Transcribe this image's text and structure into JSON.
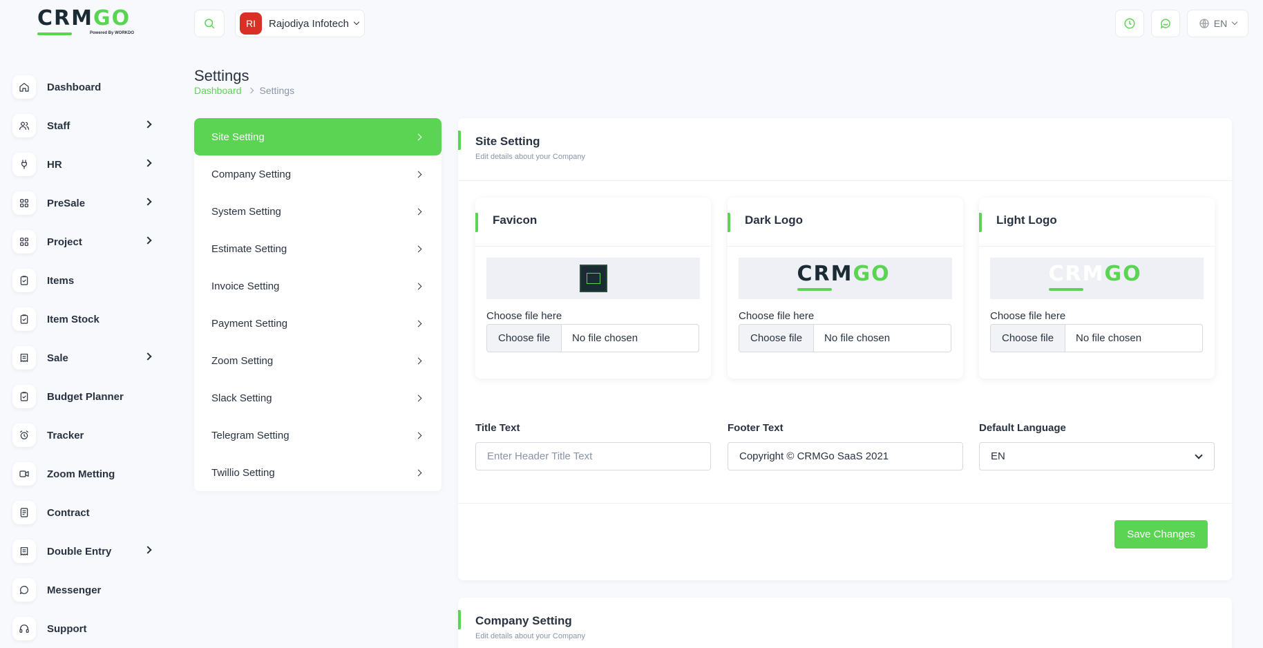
{
  "brand": {
    "logo_text_a": "CRM",
    "logo_text_b": "GO",
    "powered": "Powered By WORKDO"
  },
  "sidebar": {
    "items": [
      {
        "label": "Dashboard",
        "icon": "home-icon",
        "has_children": false
      },
      {
        "label": "Staff",
        "icon": "users-icon",
        "has_children": true
      },
      {
        "label": "HR",
        "icon": "plug-icon",
        "has_children": true
      },
      {
        "label": "PreSale",
        "icon": "grid-icon",
        "has_children": true
      },
      {
        "label": "Project",
        "icon": "grid-icon",
        "has_children": true
      },
      {
        "label": "Items",
        "icon": "clipboard-icon",
        "has_children": false
      },
      {
        "label": "Item Stock",
        "icon": "clipboard-icon",
        "has_children": false
      },
      {
        "label": "Sale",
        "icon": "receipt-icon",
        "has_children": true
      },
      {
        "label": "Budget Planner",
        "icon": "clipboard-icon",
        "has_children": false
      },
      {
        "label": "Tracker",
        "icon": "alarm-icon",
        "has_children": false
      },
      {
        "label": "Zoom Metting",
        "icon": "video-icon",
        "has_children": false
      },
      {
        "label": "Contract",
        "icon": "contract-icon",
        "has_children": false
      },
      {
        "label": "Double Entry",
        "icon": "receipt-icon",
        "has_children": true
      },
      {
        "label": "Messenger",
        "icon": "chat-icon",
        "has_children": false
      },
      {
        "label": "Support",
        "icon": "headset-icon",
        "has_children": false
      }
    ]
  },
  "header": {
    "company_initials": "RI",
    "company_name": "Rajodiya Infotech",
    "language": "EN"
  },
  "page": {
    "title": "Settings",
    "breadcrumb": {
      "home": "Dashboard",
      "current": "Settings"
    }
  },
  "settings_menu": {
    "items": [
      {
        "label": "Site Setting",
        "active": true
      },
      {
        "label": "Company Setting",
        "active": false
      },
      {
        "label": "System Setting",
        "active": false
      },
      {
        "label": "Estimate Setting",
        "active": false
      },
      {
        "label": "Invoice Setting",
        "active": false
      },
      {
        "label": "Payment Setting",
        "active": false
      },
      {
        "label": "Zoom Setting",
        "active": false
      },
      {
        "label": "Slack Setting",
        "active": false
      },
      {
        "label": "Telegram Setting",
        "active": false
      },
      {
        "label": "Twillio Setting",
        "active": false
      }
    ]
  },
  "site_setting": {
    "title": "Site Setting",
    "subtitle": "Edit details about your Company",
    "logo_cards": [
      {
        "title": "Favicon",
        "choose_label": "Choose file here",
        "button": "Choose file",
        "status": "No file chosen"
      },
      {
        "title": "Dark Logo",
        "choose_label": "Choose file here",
        "button": "Choose file",
        "status": "No file chosen"
      },
      {
        "title": "Light Logo",
        "choose_label": "Choose file here",
        "button": "Choose file",
        "status": "No file chosen"
      }
    ],
    "title_text": {
      "label": "Title Text",
      "placeholder": "Enter Header Title Text",
      "value": ""
    },
    "footer_text": {
      "label": "Footer Text",
      "value": "Copyright © CRMGo SaaS 2021"
    },
    "default_language": {
      "label": "Default Language",
      "value": "EN"
    },
    "save_label": "Save Changes"
  },
  "company_setting": {
    "title": "Company Setting",
    "subtitle": "Edit details about your Company"
  },
  "colors": {
    "accent": "#5bd453",
    "text": "#293240",
    "avatar": "#d93025"
  }
}
